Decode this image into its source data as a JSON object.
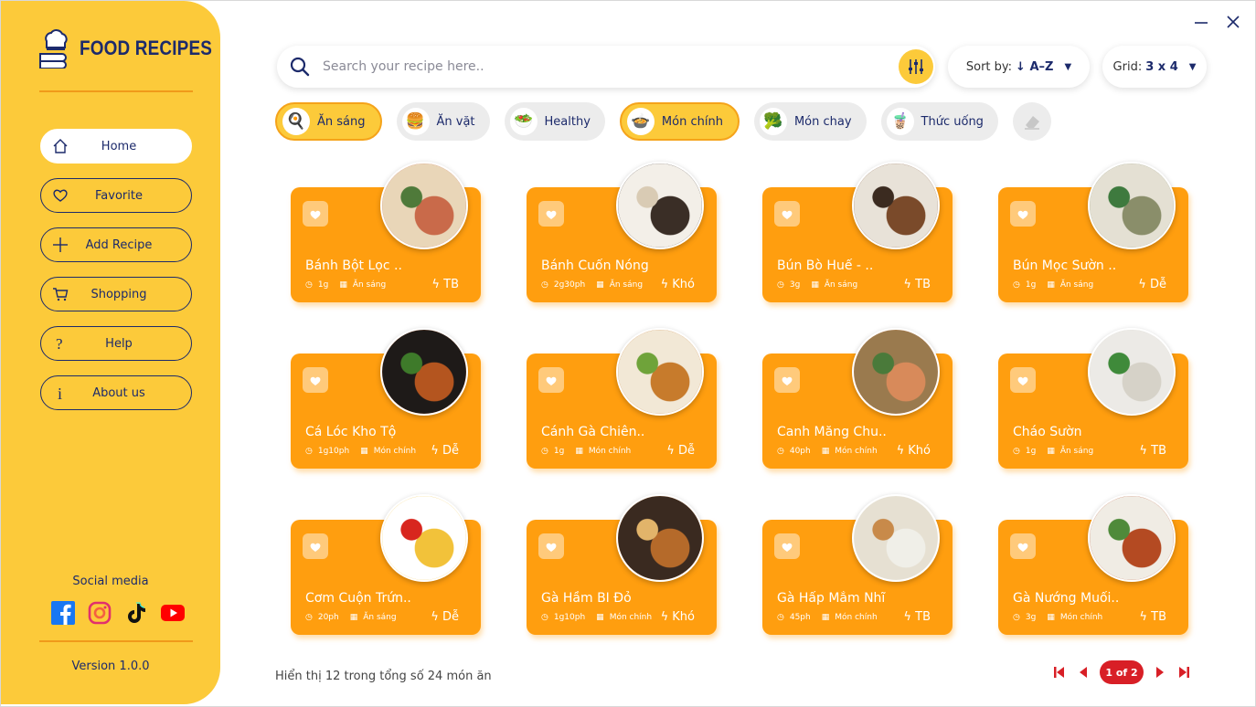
{
  "window": {
    "minimize_icon": "minimize-icon",
    "close_icon": "close-icon"
  },
  "brand": {
    "name": "FOOD RECIPES",
    "icon": "chef-book-icon"
  },
  "sidebar": {
    "items": [
      {
        "label": "Home",
        "icon": "home-icon",
        "active": true
      },
      {
        "label": "Favorite",
        "icon": "heart-icon",
        "active": false
      },
      {
        "label": "Add Recipe",
        "icon": "plus-icon",
        "active": false
      },
      {
        "label": "Shopping",
        "icon": "cart-icon",
        "active": false
      },
      {
        "label": "Help",
        "icon": "question-icon",
        "active": false
      },
      {
        "label": "About us",
        "icon": "info-icon",
        "active": false
      }
    ],
    "social_title": "Social media",
    "social": [
      "facebook-icon",
      "instagram-icon",
      "tiktok-icon",
      "youtube-icon"
    ],
    "version": "Version 1.0.0"
  },
  "search": {
    "placeholder": "Search your recipe here..",
    "value": ""
  },
  "sort": {
    "label": "Sort by:",
    "value": "↓ A–Z"
  },
  "grid_option": {
    "label": "Grid:",
    "value": "3 x 4"
  },
  "categories": [
    {
      "label": "Ăn sáng",
      "icon": "🍳",
      "active": true
    },
    {
      "label": "Ăn vặt",
      "icon": "🍔",
      "active": false
    },
    {
      "label": "Healthy",
      "icon": "🥗",
      "active": false
    },
    {
      "label": "Món chính",
      "icon": "🍲",
      "active": true
    },
    {
      "label": "Món chay",
      "icon": "🥦",
      "active": false
    },
    {
      "label": "Thức uống",
      "icon": "🧋",
      "active": false
    }
  ],
  "recipes": [
    {
      "title": "Bánh Bột Lọc ..",
      "time": "1g",
      "category": "Ăn sáng",
      "difficulty": "TB",
      "photo": [
        "#e9d6b8",
        "#c96a4a",
        "#4f7a3a"
      ]
    },
    {
      "title": "Bánh Cuốn Nóng",
      "time": "2g30ph",
      "category": "Ăn sáng",
      "difficulty": "Khó",
      "photo": [
        "#f3efe8",
        "#3a2e26",
        "#d9cbb4"
      ]
    },
    {
      "title": "Bún Bò Huế - ..",
      "time": "3g",
      "category": "Ăn sáng",
      "difficulty": "TB",
      "photo": [
        "#e8e2d8",
        "#7a4a2a",
        "#3b2b20"
      ]
    },
    {
      "title": "Bún Mọc Sườn ..",
      "time": "1g",
      "category": "Ăn sáng",
      "difficulty": "Dễ",
      "photo": [
        "#e4e0d3",
        "#8a8e6a",
        "#3e7a3e"
      ]
    },
    {
      "title": "Cá Lóc Kho Tộ",
      "time": "1g10ph",
      "category": "Món chính",
      "difficulty": "Dễ",
      "photo": [
        "#1e1a18",
        "#b4551f",
        "#3e7a2a"
      ]
    },
    {
      "title": "Cánh Gà Chiên..",
      "time": "1g",
      "category": "Món chính",
      "difficulty": "Dễ",
      "photo": [
        "#f2e8d6",
        "#c77b2c",
        "#6fa33a"
      ]
    },
    {
      "title": "Canh Măng Chu..",
      "time": "40ph",
      "category": "Món chính",
      "difficulty": "Khó",
      "photo": [
        "#9a7a4e",
        "#d88a5a",
        "#4a7a3a"
      ]
    },
    {
      "title": "Cháo Sườn",
      "time": "1g",
      "category": "Ăn sáng",
      "difficulty": "TB",
      "photo": [
        "#eceae6",
        "#d6d2c8",
        "#3f8a3a"
      ]
    },
    {
      "title": "Cơm Cuộn Trứn..",
      "time": "20ph",
      "category": "Ăn sáng",
      "difficulty": "Dễ",
      "photo": [
        "#ffffff",
        "#f2c23a",
        "#d8261e"
      ]
    },
    {
      "title": "Gà Hầm BI Đỏ",
      "time": "1g10ph",
      "category": "Món chính",
      "difficulty": "Khó",
      "photo": [
        "#3a2a20",
        "#b56a2a",
        "#e2b46a"
      ]
    },
    {
      "title": "Gà Hấp Mắm Nhĩ",
      "time": "45ph",
      "category": "Món chính",
      "difficulty": "TB",
      "photo": [
        "#e6e0d2",
        "#f0efe8",
        "#c88a4a"
      ]
    },
    {
      "title": "Gà Nướng Muối..",
      "time": "3g",
      "category": "Món chính",
      "difficulty": "TB",
      "photo": [
        "#f0ece4",
        "#b44a22",
        "#4f8a3a"
      ]
    }
  ],
  "footer": {
    "summary": "Hiển thị 12 trong tổng số 24 món ăn"
  },
  "pagination": {
    "current": 1,
    "total": 2,
    "label": "1 of 2"
  }
}
